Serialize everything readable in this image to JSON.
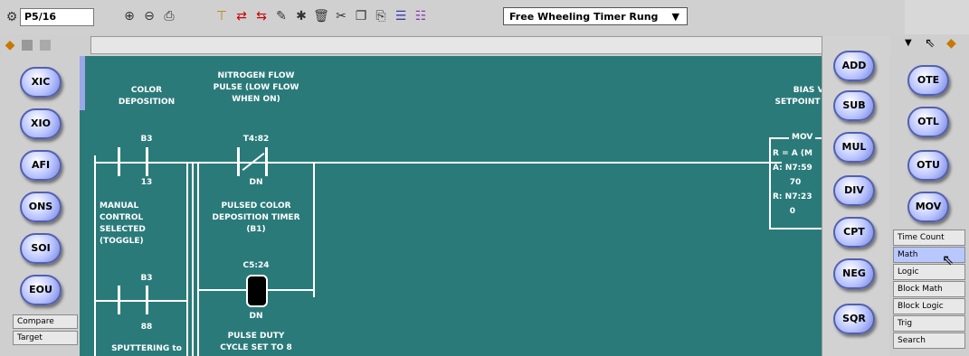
{
  "toolbar": {
    "page_number": "P5/16",
    "rung_selector": "Free Wheeling Timer Rung"
  },
  "left_palette": {
    "instructions": [
      "XIC",
      "XIO",
      "AFI",
      "ONS",
      "SOI",
      "EOU"
    ],
    "tabs": [
      "Compare",
      "Target"
    ]
  },
  "rung": {
    "col1_title": "COLOR\nDEPOSITION",
    "contact1_addr": "B3",
    "contact1_bit": "13",
    "contact1_desc": "MANUAL\nCONTROL\nSELECTED\n(TOGGLE)",
    "contact2_addr": "B3",
    "contact2_bit": "88",
    "contact2_desc": "SPUTTERING to",
    "col2_title": "NITROGEN FLOW\nPULSE (LOW FLOW\nWHEN ON)",
    "xio_addr": "T4:82",
    "xio_bit": "DN",
    "xio_desc": "PULSED COLOR\nDEPOSITION TIMER\n(B1)",
    "ote_addr": "C5:24",
    "ote_bit": "DN",
    "ote_desc": "PULSE DUTY\nCYCLE SET TO 8",
    "right_title": "BIAS VO\nSETPOINT fr",
    "mov_title": "MOV",
    "mov_lines": [
      "R = A (M",
      "A:  N7:59",
      "      70",
      "R:  N7:23",
      "      0"
    ]
  },
  "math_palette": [
    "ADD",
    "SUB",
    "MUL",
    "DIV",
    "CPT",
    "NEG",
    "SQR"
  ],
  "right_palette": {
    "instructions": [
      "OTE",
      "OTL",
      "OTU",
      "MOV"
    ],
    "categories": [
      "Time Count",
      "Math",
      "Logic",
      "Block Math",
      "Block Logic",
      "Trig",
      "Search"
    ],
    "selected": "Math"
  },
  "colors": {
    "canvas": "#2b7a7a",
    "button_fill": "#b7c2ff"
  }
}
